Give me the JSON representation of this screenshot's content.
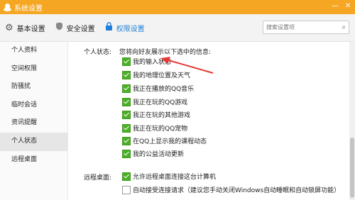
{
  "window": {
    "title": "系统设置"
  },
  "toolbar": {
    "tabs": [
      {
        "label": "基本设置",
        "icon": "gear-icon"
      },
      {
        "label": "安全设置",
        "icon": "shield-icon"
      },
      {
        "label": "权限设置",
        "icon": "lock-icon",
        "active": true
      }
    ],
    "search_placeholder": "搜索设置项"
  },
  "sidebar": {
    "items": [
      {
        "label": "个人资料"
      },
      {
        "label": "空间权限"
      },
      {
        "label": "防骚扰"
      },
      {
        "label": "临时会话"
      },
      {
        "label": "资讯提醒"
      },
      {
        "label": "个人状态",
        "selected": true
      },
      {
        "label": "远程桌面"
      }
    ]
  },
  "personal_status": {
    "label": "个人状态:",
    "hint": "您将向好友展示以下选中的信息:",
    "options": [
      {
        "label": "我的输入状态",
        "checked": true
      },
      {
        "label": "我的地理位置及天气",
        "checked": true
      },
      {
        "label": "我正在播放的QQ音乐",
        "checked": true
      },
      {
        "label": "我正在玩的QQ游戏",
        "checked": true
      },
      {
        "label": "我正在玩的其他游戏",
        "checked": true
      },
      {
        "label": "我正在玩的QQ宠物",
        "checked": true
      },
      {
        "label": "在QQ上显示我的课程动态",
        "checked": true
      },
      {
        "label": "我的公益活动更新",
        "checked": true
      }
    ]
  },
  "remote_desktop": {
    "label": "远程桌面:",
    "options": [
      {
        "label": "允许远程桌面连接这台计算机",
        "checked": true
      },
      {
        "label": "自动接受连接请求（建议您手动关闭Windows自动睡眠和自动锁屏功能）",
        "checked": false
      }
    ]
  },
  "colors": {
    "titlebar": "#f5a623",
    "accent": "#1e7fd8",
    "checkbox": "#4caf28",
    "annotation_arrow": "#e53935"
  }
}
